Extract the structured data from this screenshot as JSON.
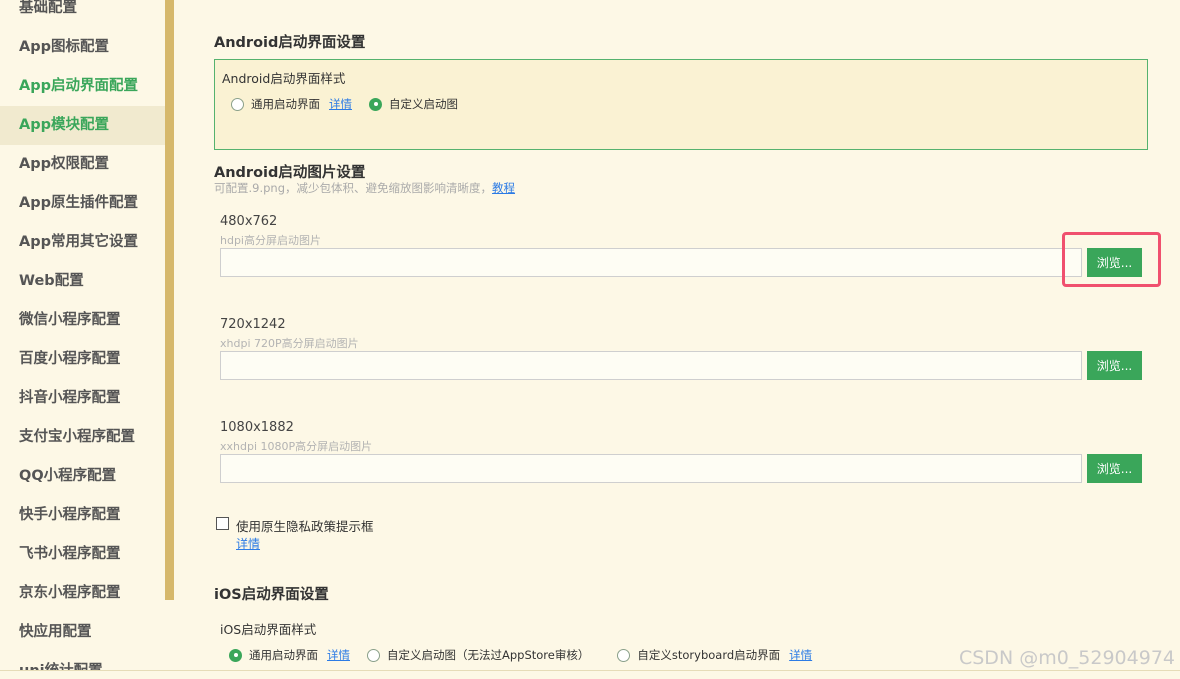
{
  "sidebar": {
    "items": [
      {
        "label": "基础配置"
      },
      {
        "label": "App图标配置"
      },
      {
        "label": "App启动界面配置"
      },
      {
        "label": "App模块配置"
      },
      {
        "label": "App权限配置"
      },
      {
        "label": "App原生插件配置"
      },
      {
        "label": "App常用其它设置"
      },
      {
        "label": "Web配置"
      },
      {
        "label": "微信小程序配置"
      },
      {
        "label": "百度小程序配置"
      },
      {
        "label": "抖音小程序配置"
      },
      {
        "label": "支付宝小程序配置"
      },
      {
        "label": "QQ小程序配置"
      },
      {
        "label": "快手小程序配置"
      },
      {
        "label": "飞书小程序配置"
      },
      {
        "label": "京东小程序配置"
      },
      {
        "label": "快应用配置"
      },
      {
        "label": "uni统计配置"
      }
    ],
    "active_index": 2,
    "hover_index": 3
  },
  "android_splash": {
    "title": "Android启动界面设置",
    "style_label": "Android启动界面样式",
    "option_default": "通用启动界面",
    "option_default_link": "详情",
    "option_custom": "自定义启动图",
    "selected": "custom"
  },
  "android_images": {
    "title": "Android启动图片设置",
    "hint": "可配置.9.png，减少包体积、避免缩放图影响清晰度，",
    "hint_link": "教程",
    "browse_label": "浏览...",
    "entries": [
      {
        "size": "480x762",
        "desc": "hdpi高分屏启动图片",
        "value": ""
      },
      {
        "size": "720x1242",
        "desc": "xhdpi 720P高分屏启动图片",
        "value": ""
      },
      {
        "size": "1080x1882",
        "desc": "xxhdpi 1080P高分屏启动图片",
        "value": ""
      }
    ]
  },
  "privacy": {
    "label": "使用原生隐私政策提示框",
    "link": "详情",
    "checked": false
  },
  "ios_splash": {
    "title": "iOS启动界面设置",
    "style_label": "iOS启动界面样式",
    "option_default": "通用启动界面",
    "option_default_link": "详情",
    "option_custom": "自定义启动图（无法过AppStore审核）",
    "option_storyboard": "自定义storyboard启动界面",
    "option_storyboard_link": "详情",
    "selected": "default"
  },
  "watermark": "CSDN @m0_52904974",
  "colors": {
    "accent": "#3aa65a",
    "highlight": "#f0506e",
    "background": "#fdf8e6",
    "rail": "#d6b86b"
  }
}
